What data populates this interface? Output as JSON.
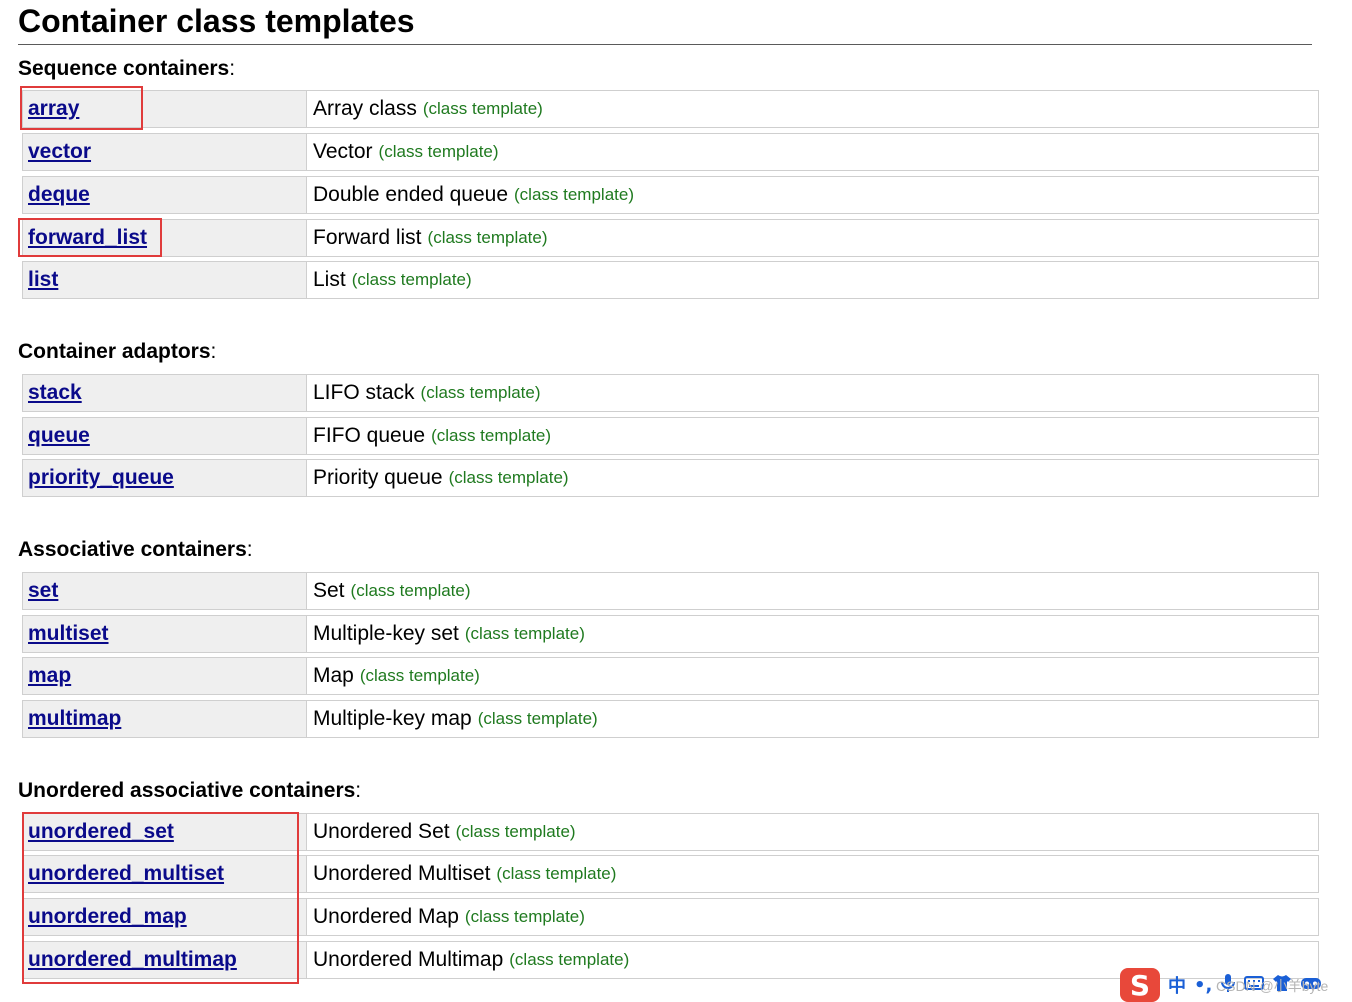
{
  "title": "Container class templates",
  "kind_label": "(class template)",
  "sections": [
    {
      "heading": "Sequence containers",
      "rows": [
        {
          "name": "array",
          "desc": "Array class"
        },
        {
          "name": "vector",
          "desc": "Vector"
        },
        {
          "name": "deque",
          "desc": "Double ended queue"
        },
        {
          "name": "forward_list",
          "desc": "Forward list"
        },
        {
          "name": "list",
          "desc": "List"
        }
      ]
    },
    {
      "heading": "Container adaptors",
      "rows": [
        {
          "name": "stack",
          "desc": "LIFO stack"
        },
        {
          "name": "queue",
          "desc": "FIFO queue"
        },
        {
          "name": "priority_queue",
          "desc": "Priority queue"
        }
      ]
    },
    {
      "heading": "Associative containers",
      "rows": [
        {
          "name": "set",
          "desc": "Set"
        },
        {
          "name": "multiset",
          "desc": "Multiple-key set"
        },
        {
          "name": "map",
          "desc": "Map"
        },
        {
          "name": "multimap",
          "desc": "Multiple-key map"
        }
      ]
    },
    {
      "heading": "Unordered associative containers",
      "rows": [
        {
          "name": "unordered_set",
          "desc": "Unordered Set"
        },
        {
          "name": "unordered_multiset",
          "desc": "Unordered Multiset"
        },
        {
          "name": "unordered_map",
          "desc": "Unordered Map"
        },
        {
          "name": "unordered_multimap",
          "desc": "Unordered Multimap"
        }
      ]
    }
  ],
  "ime": {
    "logo": "S",
    "lang": "中",
    "punct": "•,",
    "mic_icon": "microphone-icon",
    "keyboard_icon": "keyboard-icon",
    "shirt_icon": "shirt-icon",
    "game_icon": "gamepad-icon"
  },
  "watermark": "CSDN @小羊byte",
  "colors": {
    "link": "#0a0a8a",
    "kind": "#1f7a1f",
    "highlight": "#e03b3b",
    "name_cell_bg": "#efefef"
  }
}
